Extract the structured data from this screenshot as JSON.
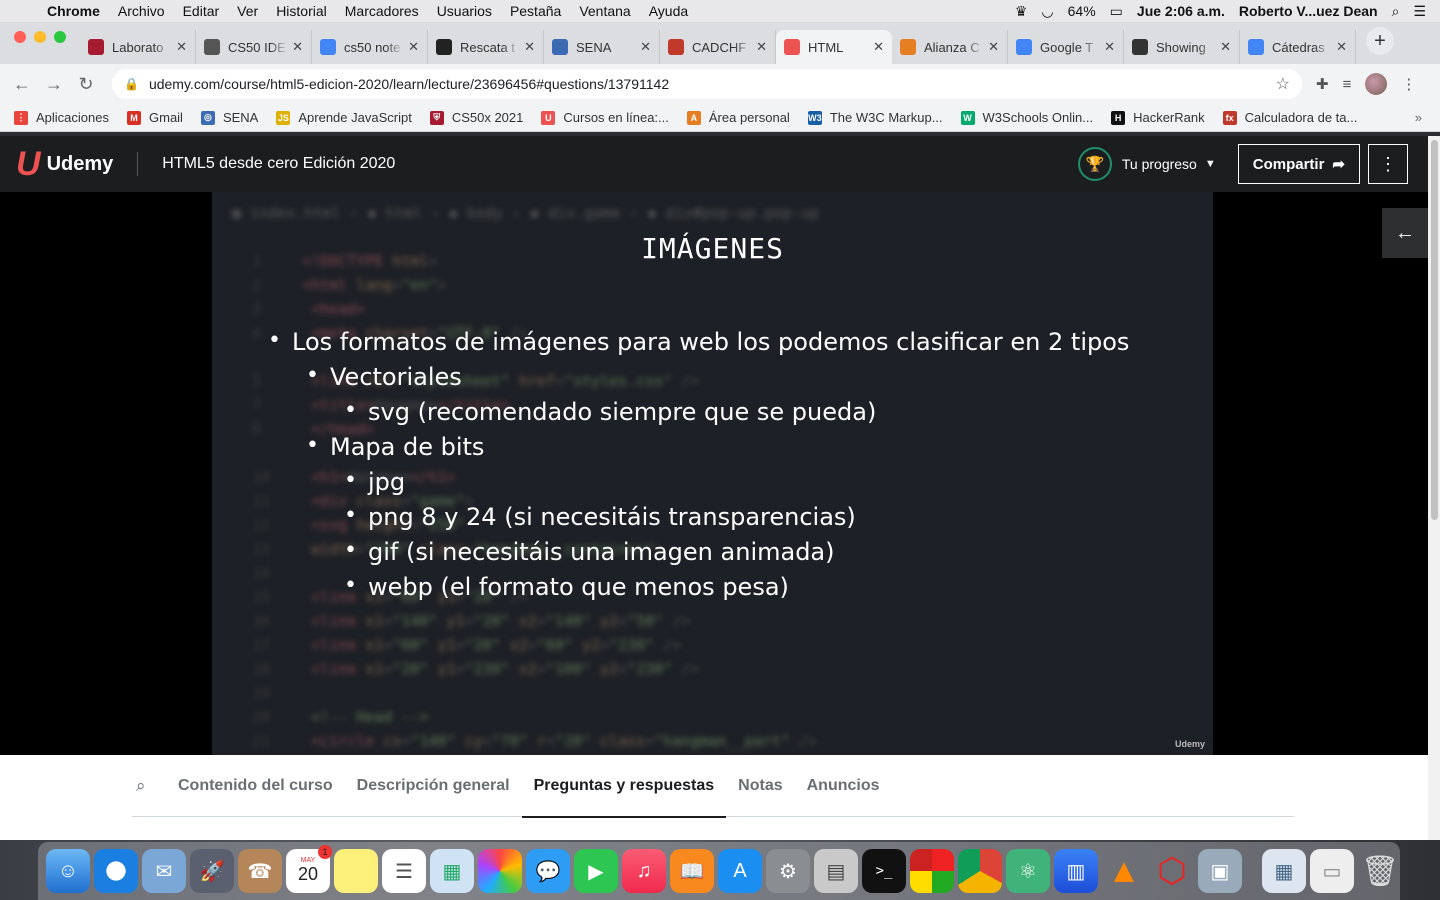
{
  "menubar": {
    "app": "Chrome",
    "items": [
      "Archivo",
      "Editar",
      "Ver",
      "Historial",
      "Marcadores",
      "Usuarios",
      "Pestaña",
      "Ventana",
      "Ayuda"
    ],
    "battery": "64%",
    "datetime": "Jue 2:06 a.m.",
    "user": "Roberto V...uez Dean"
  },
  "tabs": [
    {
      "label": "Laborato",
      "color": "#a51c30",
      "icon": "shield-icon"
    },
    {
      "label": "CS50 IDE",
      "color": "#555",
      "icon": "globe-icon"
    },
    {
      "label": "cs50 note",
      "color": "#4285f4",
      "icon": "google-icon"
    },
    {
      "label": "Rescata t",
      "color": "#222",
      "icon": "github-icon"
    },
    {
      "label": "SENA",
      "color": "#3d6bb3",
      "icon": "sena-icon"
    },
    {
      "label": "CADCHF",
      "color": "#c0392b",
      "icon": "fx-icon"
    },
    {
      "label": "HTML",
      "color": "#ec5252",
      "icon": "udemy-icon"
    },
    {
      "label": "Alianza C",
      "color": "#e67e22",
      "icon": "alianza-icon"
    },
    {
      "label": "Google T",
      "color": "#4285f4",
      "icon": "translate-icon"
    },
    {
      "label": "Showing",
      "color": "#333",
      "icon": "hackerrank-icon"
    },
    {
      "label": "Cátedras",
      "color": "#4285f4",
      "icon": "chrome-icon"
    }
  ],
  "address": {
    "url": "udemy.com/course/html5-edicion-2020/learn/lecture/23696456#questions/13791142"
  },
  "bookmarks": [
    {
      "label": "Aplicaciones",
      "color": "#e8453c",
      "glyph": "⋮"
    },
    {
      "label": "Gmail",
      "color": "#d93025",
      "glyph": "M"
    },
    {
      "label": "SENA",
      "color": "#3d6bb3",
      "glyph": "◎"
    },
    {
      "label": "Aprende JavaScript",
      "color": "#e0b000",
      "glyph": "JS"
    },
    {
      "label": "CS50x 2021",
      "color": "#a51c30",
      "glyph": "⛨"
    },
    {
      "label": "Cursos en línea:...",
      "color": "#ec5252",
      "glyph": "U"
    },
    {
      "label": "Área personal",
      "color": "#e67e22",
      "glyph": "A"
    },
    {
      "label": "The W3C Markup...",
      "color": "#1a5ea6",
      "glyph": "W3"
    },
    {
      "label": "W3Schools Onlin...",
      "color": "#04aa6d",
      "glyph": "W"
    },
    {
      "label": "HackerRank",
      "color": "#111",
      "glyph": "H"
    },
    {
      "label": "Calculadora de ta...",
      "color": "#c0392b",
      "glyph": "fx"
    }
  ],
  "udemy": {
    "brand": "Udemy",
    "course_title": "HTML5 desde cero Edición 2020",
    "progress_label": "Tu progreso",
    "share_label": "Compartir"
  },
  "slide": {
    "title": "IMÁGENES",
    "bullets": [
      {
        "text": "Los formatos de imágenes para web los podemos clasificar en 2 tipos",
        "level": 0
      },
      {
        "text": "Vectoriales",
        "level": 1
      },
      {
        "text": "svg (recomendado siempre que se pueda)",
        "level": 2
      },
      {
        "text": "Mapa de bits",
        "level": 1
      },
      {
        "text": "jpg",
        "level": 2
      },
      {
        "text": "png 8 y 24 (si necesitáis transparencias)",
        "level": 2
      },
      {
        "text": "gif (si necesitáis una imagen animada)",
        "level": 2
      },
      {
        "text": "webp (el formato que menos pesa)",
        "level": 2
      }
    ],
    "watermark": "Udemy"
  },
  "lecture_tabs": [
    {
      "label": "Contenido del curso",
      "active": false
    },
    {
      "label": "Descripción general",
      "active": false
    },
    {
      "label": "Preguntas y respuestas",
      "active": true
    },
    {
      "label": "Notas",
      "active": false
    },
    {
      "label": "Anuncios",
      "active": false
    }
  ],
  "dock": {
    "calendar_month": "MAY",
    "calendar_day": "20",
    "calendar_badge": "1"
  }
}
